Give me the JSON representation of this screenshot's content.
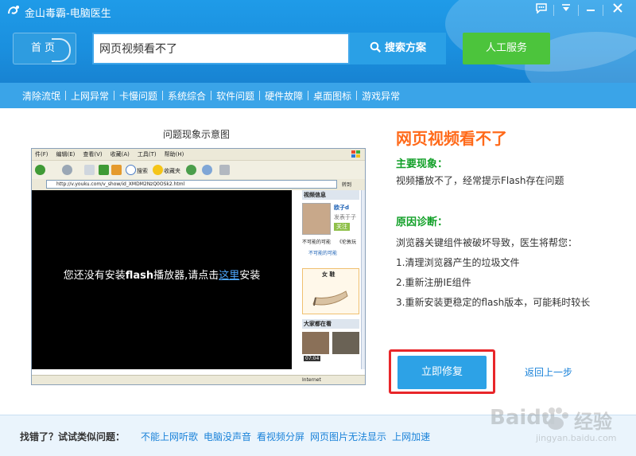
{
  "window": {
    "title": "金山毒霸-电脑医生"
  },
  "header": {
    "home_label": "首页",
    "search": {
      "value": "网页视频看不了",
      "button_label": "搜索方案"
    },
    "human_service_label": "人工服务"
  },
  "categories": [
    "清除流氓",
    "上网异常",
    "卡慢问题",
    "系统综合",
    "软件问题",
    "硬件故障",
    "桌面图标",
    "游戏异常"
  ],
  "demo": {
    "caption": "问题现象示意图",
    "menu": [
      "件(F)",
      "编辑(E)",
      "查看(V)",
      "收藏(A)",
      "工具(T)",
      "帮助(H)"
    ],
    "toolbar": {
      "search": "搜索",
      "favorites": "收藏夹"
    },
    "address": "http://v.youku.com/v_show/id_XMDM2NzQ0OSk2.html",
    "go_label": "转到",
    "video_message_pre": "您还没有安装",
    "video_message_bold": "flash",
    "video_message_mid": "播放器,请点击",
    "video_message_link": "这里",
    "video_message_post": "安装",
    "side_head_1": "视频信息",
    "side_user": "欧子d",
    "side_user_sub": "发表于子",
    "side_follow": "关注",
    "side_note_1": "不可能的可能",
    "side_note_2": "《伦敦玩",
    "side_share": "不可能的可能",
    "side_shoe": "女  鞋",
    "side_head_2": "大家都在看",
    "side_time": "07:04",
    "status_text": "Internet"
  },
  "issue": {
    "title": "网页视频看不了",
    "symptom_heading": "主要现象：",
    "symptom_text": "视频播放不了，经常提示Flash存在问题",
    "diagnosis_heading": "原因诊断：",
    "diagnosis_intro": "浏览器关键组件被破坏导致，医生将帮您：",
    "steps": [
      "1.清理浏览器产生的垃圾文件",
      "2.重新注册IE组件",
      "3.重新安装更稳定的flash版本，可能耗时较长"
    ]
  },
  "actions": {
    "fix_label": "立即修复",
    "back_label": "返回上一步"
  },
  "footer": {
    "label": "找错了？试试类似问题：",
    "links": [
      "不能上网听歌",
      "电脑没声音",
      "看视频分屏",
      "网页图片无法显示",
      "上网加速"
    ]
  },
  "watermark": {
    "brand": "Baidu",
    "brand_cn": "经验",
    "url": "jingyan.baidu.com"
  },
  "colors": {
    "header_blue": "#1f9be8",
    "accent_orange": "#ff6a1a",
    "heading_green": "#12a028",
    "service_green": "#4cc43c",
    "highlight_red": "#e8262a",
    "link_blue": "#1a82d9"
  }
}
